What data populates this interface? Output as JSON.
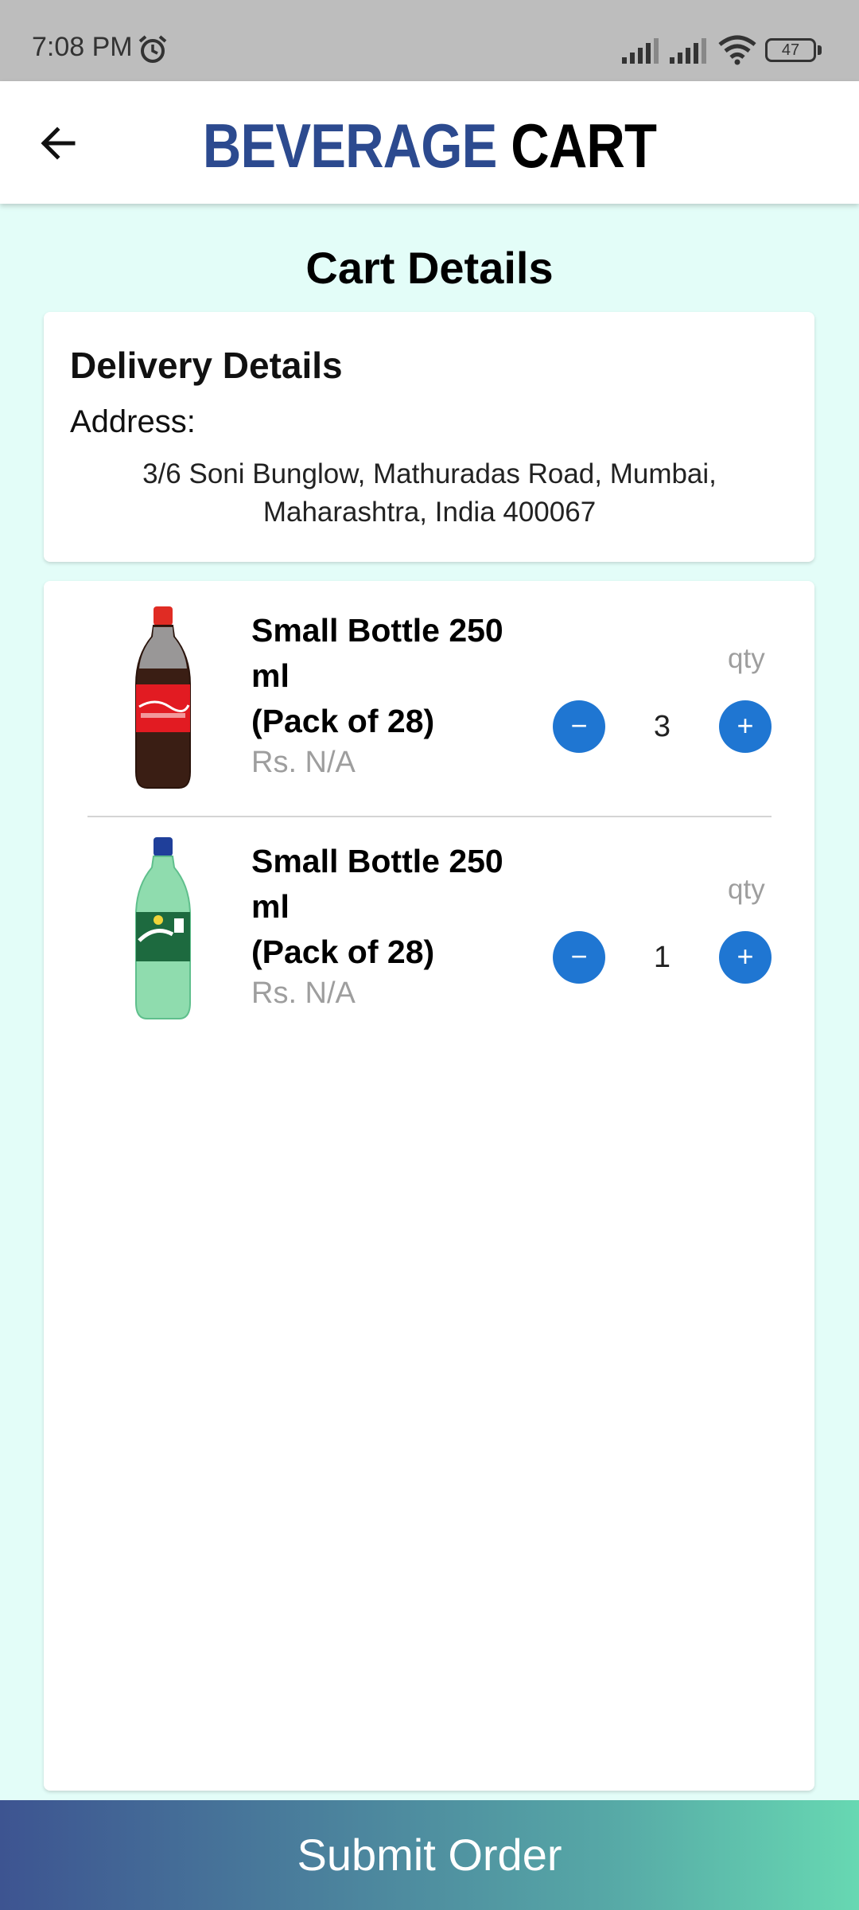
{
  "status_bar": {
    "time": "7:08 PM",
    "battery": "47",
    "icons": [
      "alarm-icon",
      "signal-icon",
      "signal-icon",
      "wifi-icon",
      "battery-icon"
    ]
  },
  "app_bar": {
    "back_icon": "arrow-left-icon",
    "brand_part1": "BEVERAGE",
    "brand_part2": "CART",
    "brand_color_part1": "#2c4a8f",
    "brand_color_part2": "#000000"
  },
  "page": {
    "title": "Cart Details"
  },
  "delivery": {
    "title": "Delivery Details",
    "address_label": "Address:",
    "address": "3/6 Soni Bunglow, Mathuradas Road, Mumbai, Maharashtra, India 400067"
  },
  "items": [
    {
      "name_line1": "Small Bottle 250",
      "name_line2": "ml",
      "name_line3": "(Pack of 28)",
      "price": "Rs. N/A",
      "qty_label": "qty",
      "qty": "3",
      "image": "coca-cola-bottle-image"
    },
    {
      "name_line1": "Small Bottle 250",
      "name_line2": "ml",
      "name_line3": "(Pack of 28)",
      "price": "Rs. N/A",
      "qty_label": "qty",
      "qty": "1",
      "image": "sprite-bottle-image"
    }
  ],
  "qty_controls": {
    "minus": "−",
    "plus": "+",
    "button_color": "#1f76d2"
  },
  "submit": {
    "label": "Submit Order"
  }
}
